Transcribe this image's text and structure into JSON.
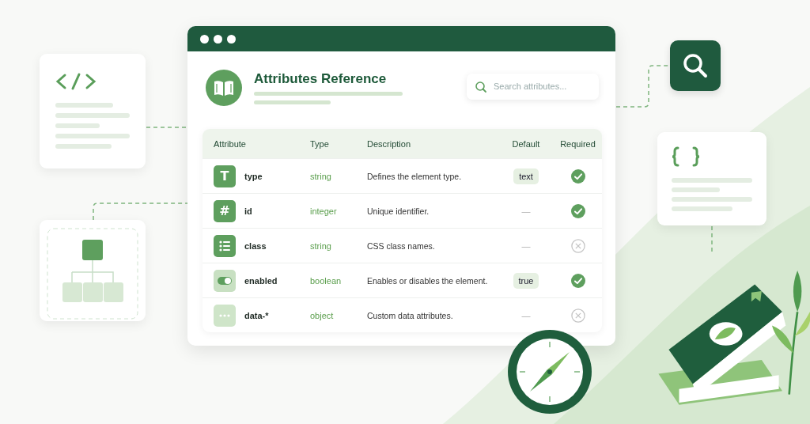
{
  "window": {
    "title": "Attributes Reference"
  },
  "search": {
    "placeholder": "Search attributes..."
  },
  "table": {
    "columns": [
      "Attribute",
      "Type",
      "Description",
      "Default",
      "Required"
    ],
    "rows": [
      {
        "kind": "glyph",
        "icon": "T",
        "name": "type",
        "type": "string",
        "description": "Defines the element type.",
        "default": "text",
        "required": true
      },
      {
        "kind": "glyph",
        "icon": "#",
        "name": "id",
        "type": "integer",
        "description": "Unique identifier.",
        "default": "—",
        "required": true
      },
      {
        "kind": "list",
        "name": "class",
        "type": "string",
        "description": "CSS class names.",
        "default": "—",
        "required": false
      },
      {
        "kind": "toggle",
        "name": "enabled",
        "type": "boolean",
        "description": "Enables or disables the element.",
        "default": "true",
        "required": true
      },
      {
        "kind": "more",
        "name": "data-*",
        "type": "object",
        "description": "Custom data attributes.",
        "default": "—",
        "required": false
      }
    ]
  }
}
